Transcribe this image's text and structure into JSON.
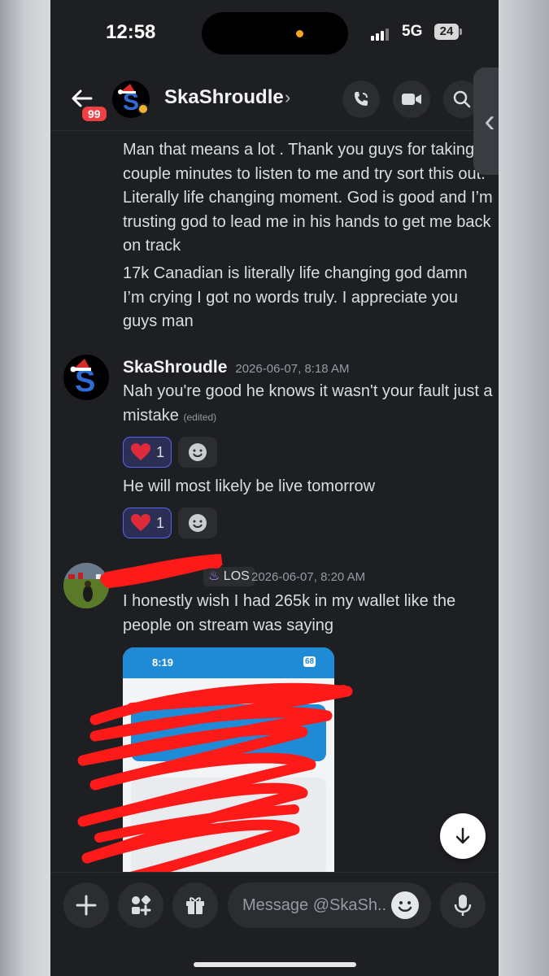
{
  "status": {
    "time": "12:58",
    "network": "5G",
    "battery": "24"
  },
  "header": {
    "badge_count": "99",
    "name": "SkaShroudle",
    "chevron": "›"
  },
  "messages": {
    "first_group": {
      "lines_a": "Man that means a lot . Thank you guys for taking couple minutes to listen to me and try sort this out. Literally life changing moment. God is good and I’m trusting god to lead me in his hands to get me back on track",
      "lines_b": "17k Canadian is literally life changing god damn I’m crying I got no words truly. I appreciate you guys man"
    },
    "second_group": {
      "author": "SkaShroudle",
      "timestamp": "2026-06-07, 8:18 AM",
      "text1": "Nah you're good he knows it wasn't your fault just a mistake",
      "edited": "(edited)",
      "reaction1_count": "1",
      "text2": "He will most likely be live tomorrow",
      "reaction2_count": "1"
    },
    "third_group": {
      "tag": "LOS",
      "timestamp": "2026-06-07, 8:20 AM",
      "text": "I honestly wish I had 265k in my wallet like the people on stream was saying",
      "attachment_time": "8:19",
      "attachment_battery": "68"
    }
  },
  "composer": {
    "placeholder": "Message @SkaSh.."
  }
}
